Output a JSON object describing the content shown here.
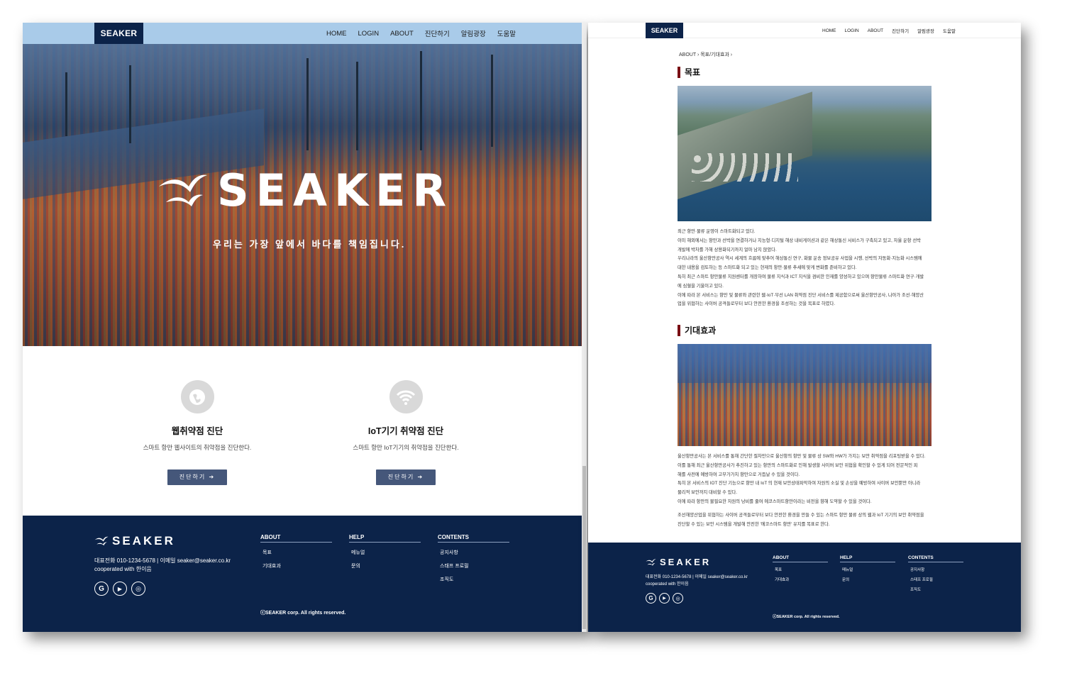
{
  "left": {
    "brand": "SEAKER",
    "nav": [
      "HOME",
      "LOGIN",
      "ABOUT",
      "진단하기",
      "알림광장",
      "도움말"
    ],
    "hero": {
      "logo_text": "SEAKER",
      "tagline": "우리는 가장 앞에서 바다를 책임집니다."
    },
    "services": [
      {
        "title": "웹취약점 진단",
        "desc": "스마트 항만 웹사이트의 취약점을 진단한다.",
        "button": "진단하기",
        "icon": "globe-icon"
      },
      {
        "title": "IoT기기 취약점 진단",
        "desc": "스마트 항만 IoT기기의 취약점을 진단한다.",
        "button": "진단하기",
        "icon": "wifi-icon"
      }
    ]
  },
  "footer": {
    "logo_text": "SEAKER",
    "contact": "대표전화 010-1234-5678 | 이메일 seaker@seaker.co.kr",
    "cooperated": "cooperated with 한이음",
    "social": [
      "google-icon",
      "youtube-icon",
      "instagram-icon"
    ],
    "columns": [
      {
        "heading": "ABOUT",
        "items": [
          "목표",
          "기대효과"
        ]
      },
      {
        "heading": "HELP",
        "items": [
          "메뉴얼",
          "문의"
        ]
      },
      {
        "heading": "CONTENTS",
        "items": [
          "공지사항",
          "스태프 프로필",
          "조직도"
        ]
      }
    ],
    "copyright": "ⓒSEAKER corp. All rights reserved."
  },
  "right": {
    "brand": "SEAKER",
    "nav": [
      "HOME",
      "LOGIN",
      "ABOUT",
      "진단하기",
      "알림광장",
      "도움말"
    ],
    "breadcrumb": [
      "ABOUT",
      "목표/기대효과"
    ],
    "goal_title": "목표",
    "goal_text": [
      "최근 항만·물류 운영이 스마트화되고 있다.",
      "이미 해외에서는 항만과 선박을 연결하거나 지능형·디지털 해상 내비게이션과 같은 해상통신 서비스가 구축되고 있고, 자율 운항 선박",
      "개발에 박차를 가해 상용화되기까지 얼마 남지 않았다.",
      "우리나라의 울산항만공사 역시 세계의 흐름에 맞추어 해상통신 연구, 화물 운송 정보공유 사업을 시행, 선박의 자동화·지능화 시스템에",
      "대한 내용을 검토하는 등 스마트화 되고 있는 현재의 항만·물류 추세에 맞게 변화를 준비하고 있다.",
      "특히 최근 스마트 항만물류 지원센터를 개장하여 물류 지식과 ICT 지식을 겸비한 인재를 양성하고 있으며 항만물류 스마트화 연구·개발",
      "에 심혈을 기울이고 있다.",
      "이에 따라 본 서비스는 항만 및 물류와 관련한 웹·IoT·무선 LAN 취약점 진단 서비스를 제공함으로써 울산항만공사, 나아가 조선·해양산",
      "업을 위협하는 사이버 공격들로부터 보다 안전한 환경을 조성하는 것을 목표로 하였다."
    ],
    "effect_title": "기대효과",
    "effect_text": [
      "울산항만공사는 본 서비스를 통해 간단한 절차만으로 울산항의 항만 및 물류 상 SW와 HW가 가지는 보안 취약점을 리포팅받을 수 있다.",
      "이를 통해 최근 울산항만공사가 추진하고 있는 항만의 스마트화로 인해 발생할 사이버 보안 위협을 확인할 수 있게 되어 전문적인 피",
      "해를 사전에 예방하여 고부가가치 항만으로 거듭날 수 있을 것이다.",
      "특히 본 서비스의 IOT 진단 기능으로 항만 내 IoT 의 현재 보안상태파악하여 자원의 소실 및 손상을 예방하여 사이버 보안뿐만 아니라",
      "물리적 보안까지 대비할 수 있다.",
      "이에 따라 항만의 불필요한 자원의 낭비를 줄여 에코스마트항만이라는 비전을 향해 도약할 수 있을 것이다.",
      "",
      "조선해양산업을 위협하는 사이버 공격들로부터 보다 안전한 환경을 만들 수 있는 스마트 항만 물류 상의 웹과 IoT 기기의 보안 취약점을",
      "진단할 수 있는 보안 시스템을 개발해 안전한 '에코스마트 항만' 유지를 목표로 한다."
    ]
  }
}
